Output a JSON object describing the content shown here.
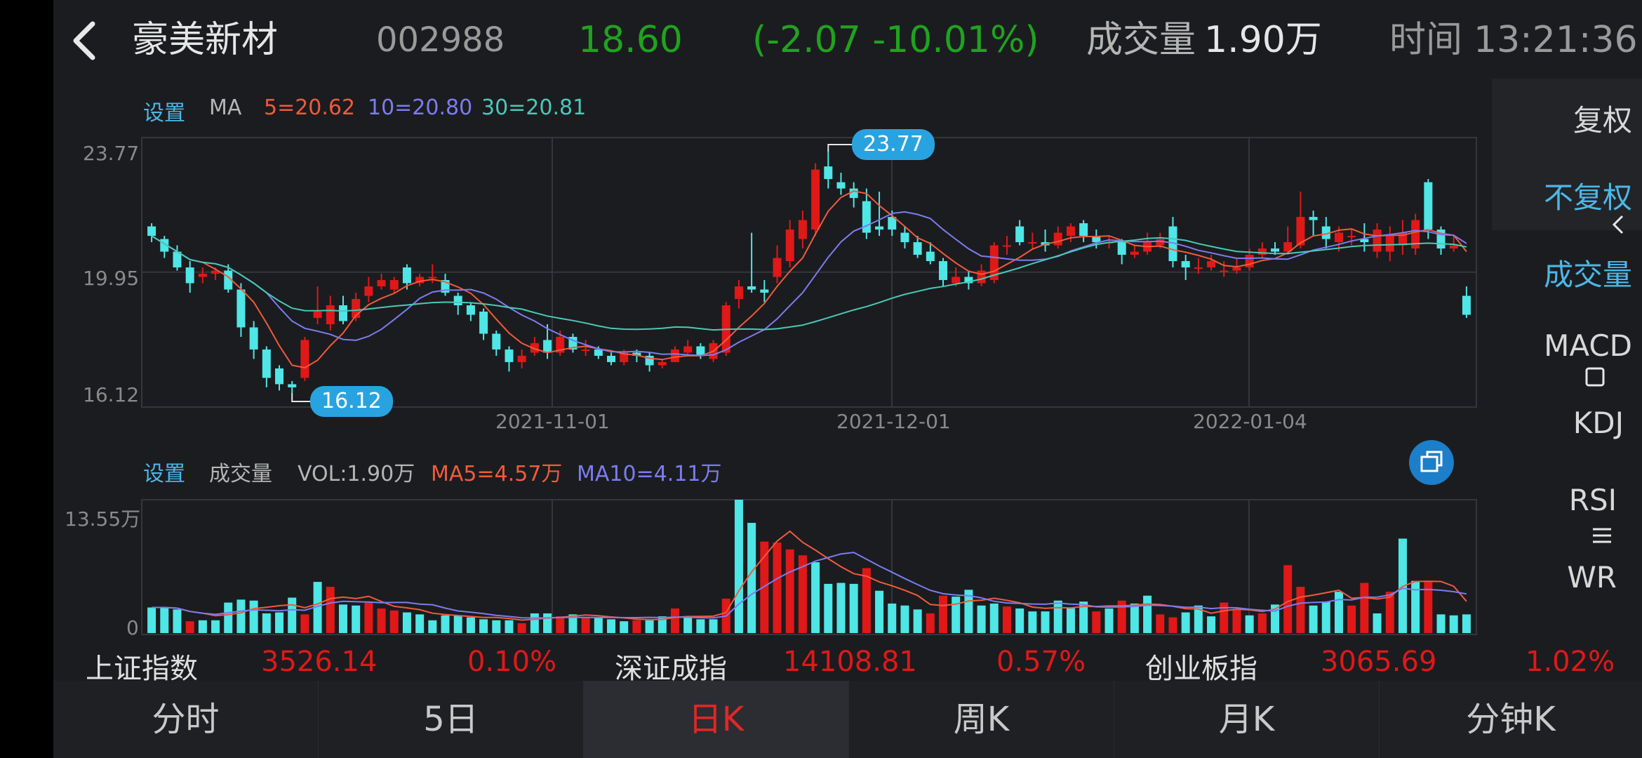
{
  "header": {
    "name": "豪美新材",
    "code": "002988",
    "price": "18.60",
    "change": "(-2.07  -10.01%)",
    "volume_label": "成交量",
    "volume_value": "1.90万",
    "time_label": "时间",
    "time_value": "13:21:36"
  },
  "ma_legend": {
    "settings": "设置",
    "ma": "MA",
    "ma5": "5=20.62",
    "ma10": "10=20.80",
    "ma30": "30=20.81"
  },
  "price_axis": {
    "top": "23.77",
    "mid": "19.95",
    "bottom": "16.12"
  },
  "price_markers": {
    "high": "23.77",
    "low": "16.12"
  },
  "dates": [
    "2021-11-01",
    "2021-12-01",
    "2022-01-04"
  ],
  "vol_legend": {
    "settings": "设置",
    "title": "成交量",
    "vol": "VOL:1.90万",
    "ma5": "MA5=4.57万",
    "ma10": "MA10=4.11万"
  },
  "vol_axis": {
    "top": "13.55万",
    "bottom": "0"
  },
  "side_menu": {
    "fuquan": "复权",
    "bufuquan": "不复权",
    "chengjiaoliang": "成交量",
    "macd": "MACD",
    "kdj": "KDJ",
    "rsi": "RSI",
    "wr": "WR"
  },
  "indices": [
    {
      "name": "上证指数",
      "value": "3526.14",
      "pct": "0.10%"
    },
    {
      "name": "深证成指",
      "value": "14108.81",
      "pct": "0.57%"
    },
    {
      "name": "创业板指",
      "value": "3065.69",
      "pct": "1.02%"
    }
  ],
  "tabs": [
    "分时",
    "5日",
    "日K",
    "周K",
    "月K",
    "分钟K"
  ],
  "colors": {
    "up": "#e01818",
    "down": "#4ee6e6",
    "ma5": "#f05a3c",
    "ma10": "#7c7cf0",
    "ma30": "#49c9b8",
    "accent": "#29a3e0",
    "green": "#1fa31f"
  },
  "chart_data": {
    "type": "candlestick",
    "ylim": [
      16.12,
      23.77
    ],
    "candles": [
      [
        21.4,
        21.1,
        21.5,
        20.9
      ],
      [
        21.0,
        20.6,
        21.1,
        20.4
      ],
      [
        20.6,
        20.1,
        20.8,
        20.0
      ],
      [
        20.1,
        19.6,
        20.3,
        19.3
      ],
      [
        19.8,
        19.9,
        20.1,
        19.6
      ],
      [
        19.9,
        20.0,
        20.1,
        19.7
      ],
      [
        20.0,
        19.4,
        20.2,
        19.3
      ],
      [
        19.4,
        18.2,
        19.6,
        17.9
      ],
      [
        18.2,
        17.5,
        18.4,
        17.2
      ],
      [
        17.5,
        16.6,
        17.6,
        16.3
      ],
      [
        16.9,
        16.4,
        17.0,
        16.2
      ],
      [
        16.4,
        16.3,
        16.5,
        16.12
      ],
      [
        16.6,
        17.8,
        17.9,
        16.5
      ],
      [
        18.5,
        18.7,
        19.5,
        18.3
      ],
      [
        18.3,
        18.9,
        19.2,
        18.1
      ],
      [
        18.9,
        18.4,
        19.2,
        18.3
      ],
      [
        18.5,
        19.1,
        19.3,
        18.4
      ],
      [
        19.2,
        19.5,
        19.8,
        19.0
      ],
      [
        19.5,
        19.7,
        19.9,
        19.4
      ],
      [
        19.4,
        19.7,
        19.8,
        19.3
      ],
      [
        20.1,
        19.6,
        20.2,
        19.4
      ],
      [
        19.6,
        19.8,
        19.9,
        19.5
      ],
      [
        19.8,
        19.8,
        20.2,
        19.6
      ],
      [
        19.7,
        19.3,
        19.9,
        19.2
      ],
      [
        19.2,
        18.9,
        19.3,
        18.6
      ],
      [
        18.9,
        18.6,
        19.0,
        18.4
      ],
      [
        18.7,
        18.0,
        18.8,
        17.8
      ],
      [
        18.0,
        17.5,
        18.1,
        17.3
      ],
      [
        17.5,
        17.1,
        17.6,
        16.8
      ],
      [
        17.1,
        17.3,
        17.5,
        16.9
      ],
      [
        17.4,
        17.7,
        17.9,
        17.3
      ],
      [
        17.8,
        17.4,
        18.3,
        17.2
      ],
      [
        17.4,
        17.9,
        18.1,
        17.3
      ],
      [
        17.9,
        17.5,
        18.0,
        17.4
      ],
      [
        17.5,
        17.5,
        17.8,
        17.3
      ],
      [
        17.5,
        17.3,
        17.6,
        17.2
      ],
      [
        17.3,
        17.1,
        17.4,
        17.0
      ],
      [
        17.1,
        17.4,
        17.5,
        17.0
      ],
      [
        17.4,
        17.3,
        17.5,
        17.1
      ],
      [
        17.3,
        17.0,
        17.4,
        16.8
      ],
      [
        17.0,
        17.1,
        17.2,
        16.9
      ],
      [
        17.1,
        17.5,
        17.6,
        17.1
      ],
      [
        17.4,
        17.6,
        17.8,
        17.3
      ],
      [
        17.6,
        17.3,
        17.7,
        17.2
      ],
      [
        17.2,
        17.7,
        17.8,
        17.1
      ],
      [
        17.4,
        18.9,
        19.0,
        17.3
      ],
      [
        19.1,
        19.5,
        19.7,
        18.8
      ],
      [
        19.5,
        19.4,
        21.2,
        19.3
      ],
      [
        19.4,
        19.3,
        19.7,
        19.0
      ],
      [
        19.8,
        20.4,
        20.8,
        19.6
      ],
      [
        20.3,
        21.3,
        21.6,
        20.1
      ],
      [
        21.0,
        21.6,
        21.9,
        20.7
      ],
      [
        21.3,
        23.2,
        23.4,
        21.1
      ],
      [
        23.3,
        22.9,
        23.77,
        22.6
      ],
      [
        22.8,
        22.6,
        23.1,
        22.4
      ],
      [
        22.6,
        22.3,
        22.8,
        22.0
      ],
      [
        22.2,
        21.2,
        22.6,
        21.0
      ],
      [
        21.4,
        21.3,
        22.5,
        21.1
      ],
      [
        21.7,
        21.3,
        21.9,
        21.1
      ],
      [
        21.2,
        20.9,
        21.4,
        20.7
      ],
      [
        20.9,
        20.5,
        21.1,
        20.4
      ],
      [
        20.6,
        20.3,
        20.9,
        20.2
      ],
      [
        20.3,
        19.7,
        20.4,
        19.5
      ],
      [
        19.6,
        19.8,
        20.1,
        19.5
      ],
      [
        19.8,
        19.6,
        20.0,
        19.4
      ],
      [
        19.6,
        20.0,
        20.2,
        19.5
      ],
      [
        19.7,
        20.8,
        20.9,
        19.6
      ],
      [
        20.8,
        20.8,
        21.1,
        20.5
      ],
      [
        21.4,
        20.9,
        21.6,
        20.8
      ],
      [
        20.9,
        20.9,
        21.2,
        20.7
      ],
      [
        20.9,
        20.8,
        21.3,
        20.6
      ],
      [
        20.8,
        21.2,
        21.4,
        20.7
      ],
      [
        21.1,
        21.4,
        21.5,
        20.9
      ],
      [
        21.5,
        21.1,
        21.6,
        20.9
      ],
      [
        21.1,
        20.9,
        21.3,
        20.7
      ],
      [
        20.9,
        20.9,
        21.1,
        20.7
      ],
      [
        20.9,
        20.5,
        21.0,
        20.2
      ],
      [
        20.5,
        20.6,
        20.8,
        20.4
      ],
      [
        20.6,
        20.9,
        21.2,
        20.5
      ],
      [
        20.8,
        21.0,
        21.2,
        20.7
      ],
      [
        21.4,
        20.3,
        21.7,
        20.1
      ],
      [
        20.3,
        20.1,
        20.5,
        19.7
      ],
      [
        20.1,
        20.1,
        20.4,
        19.9
      ],
      [
        20.1,
        20.3,
        20.5,
        20.0
      ],
      [
        20.0,
        20.0,
        20.3,
        19.8
      ],
      [
        20.0,
        20.1,
        20.4,
        19.9
      ],
      [
        20.1,
        20.5,
        20.7,
        20.0
      ],
      [
        20.5,
        20.7,
        20.9,
        20.4
      ],
      [
        20.7,
        20.6,
        20.9,
        20.5
      ],
      [
        20.6,
        20.9,
        21.4,
        20.5
      ],
      [
        20.8,
        21.7,
        22.5,
        20.7
      ],
      [
        21.7,
        21.6,
        21.9,
        21.1
      ],
      [
        21.4,
        21.0,
        21.7,
        20.7
      ],
      [
        20.9,
        21.2,
        21.4,
        20.6
      ],
      [
        21.1,
        21.1,
        21.3,
        20.8
      ],
      [
        21.0,
        20.9,
        21.5,
        20.6
      ],
      [
        20.6,
        21.3,
        21.5,
        20.4
      ],
      [
        20.6,
        21.1,
        21.4,
        20.3
      ],
      [
        20.8,
        21.2,
        21.6,
        20.5
      ],
      [
        20.7,
        21.6,
        21.8,
        20.5
      ],
      [
        22.8,
        21.3,
        22.9,
        21.0
      ],
      [
        21.3,
        20.7,
        21.4,
        20.5
      ],
      [
        20.7,
        20.8,
        21.1,
        20.6
      ],
      [
        19.2,
        18.6,
        19.5,
        18.5
      ]
    ],
    "volume_ylim": [
      0,
      13.55
    ],
    "volumes": [
      [
        2.6,
        0
      ],
      [
        2.6,
        0
      ],
      [
        2.4,
        0
      ],
      [
        1.2,
        1
      ],
      [
        1.3,
        0
      ],
      [
        1.3,
        0
      ],
      [
        3.1,
        0
      ],
      [
        3.4,
        0
      ],
      [
        3.3,
        0
      ],
      [
        2.0,
        0
      ],
      [
        2.1,
        0
      ],
      [
        3.6,
        0
      ],
      [
        1.9,
        1
      ],
      [
        5.2,
        0
      ],
      [
        4.7,
        1
      ],
      [
        2.9,
        0
      ],
      [
        2.8,
        0
      ],
      [
        3.1,
        1
      ],
      [
        2.5,
        1
      ],
      [
        2.3,
        1
      ],
      [
        2.1,
        0
      ],
      [
        1.9,
        0
      ],
      [
        1.3,
        0
      ],
      [
        1.8,
        0
      ],
      [
        1.8,
        0
      ],
      [
        1.6,
        0
      ],
      [
        1.4,
        0
      ],
      [
        1.3,
        0
      ],
      [
        1.3,
        0
      ],
      [
        1.0,
        1
      ],
      [
        2.0,
        0
      ],
      [
        2.0,
        0
      ],
      [
        1.7,
        1
      ],
      [
        1.9,
        0
      ],
      [
        1.6,
        1
      ],
      [
        1.6,
        0
      ],
      [
        1.4,
        0
      ],
      [
        1.2,
        0
      ],
      [
        1.3,
        1
      ],
      [
        1.3,
        0
      ],
      [
        1.7,
        0
      ],
      [
        2.5,
        1
      ],
      [
        1.6,
        0
      ],
      [
        1.4,
        0
      ],
      [
        1.4,
        0
      ],
      [
        3.5,
        1
      ],
      [
        13.55,
        0
      ],
      [
        11.2,
        0
      ],
      [
        9.3,
        1
      ],
      [
        9.2,
        1
      ],
      [
        8.5,
        1
      ],
      [
        7.9,
        1
      ],
      [
        7.2,
        0
      ],
      [
        5.0,
        0
      ],
      [
        5.1,
        0
      ],
      [
        5.0,
        0
      ],
      [
        6.6,
        1
      ],
      [
        4.3,
        0
      ],
      [
        3.0,
        0
      ],
      [
        2.8,
        0
      ],
      [
        2.4,
        0
      ],
      [
        2.0,
        1
      ],
      [
        3.8,
        1
      ],
      [
        3.7,
        0
      ],
      [
        4.4,
        0
      ],
      [
        2.8,
        0
      ],
      [
        3.0,
        0
      ],
      [
        2.7,
        1
      ],
      [
        2.5,
        0
      ],
      [
        2.2,
        0
      ],
      [
        2.2,
        0
      ],
      [
        3.3,
        0
      ],
      [
        2.6,
        0
      ],
      [
        3.2,
        0
      ],
      [
        2.2,
        1
      ],
      [
        2.5,
        0
      ],
      [
        3.3,
        1
      ],
      [
        3.0,
        0
      ],
      [
        3.8,
        0
      ],
      [
        1.9,
        1
      ],
      [
        1.6,
        1
      ],
      [
        2.1,
        0
      ],
      [
        2.8,
        0
      ],
      [
        1.7,
        0
      ],
      [
        3.1,
        1
      ],
      [
        2.4,
        1
      ],
      [
        1.8,
        0
      ],
      [
        2.0,
        1
      ],
      [
        2.9,
        0
      ],
      [
        6.9,
        1
      ],
      [
        4.7,
        1
      ],
      [
        2.8,
        0
      ],
      [
        3.2,
        0
      ],
      [
        4.2,
        0
      ],
      [
        2.8,
        1
      ],
      [
        5.1,
        1
      ],
      [
        2.0,
        0
      ],
      [
        4.2,
        1
      ],
      [
        9.6,
        0
      ],
      [
        5.3,
        0
      ],
      [
        5.2,
        1
      ],
      [
        1.9,
        0
      ],
      [
        1.8,
        0
      ],
      [
        1.9,
        0
      ]
    ]
  }
}
